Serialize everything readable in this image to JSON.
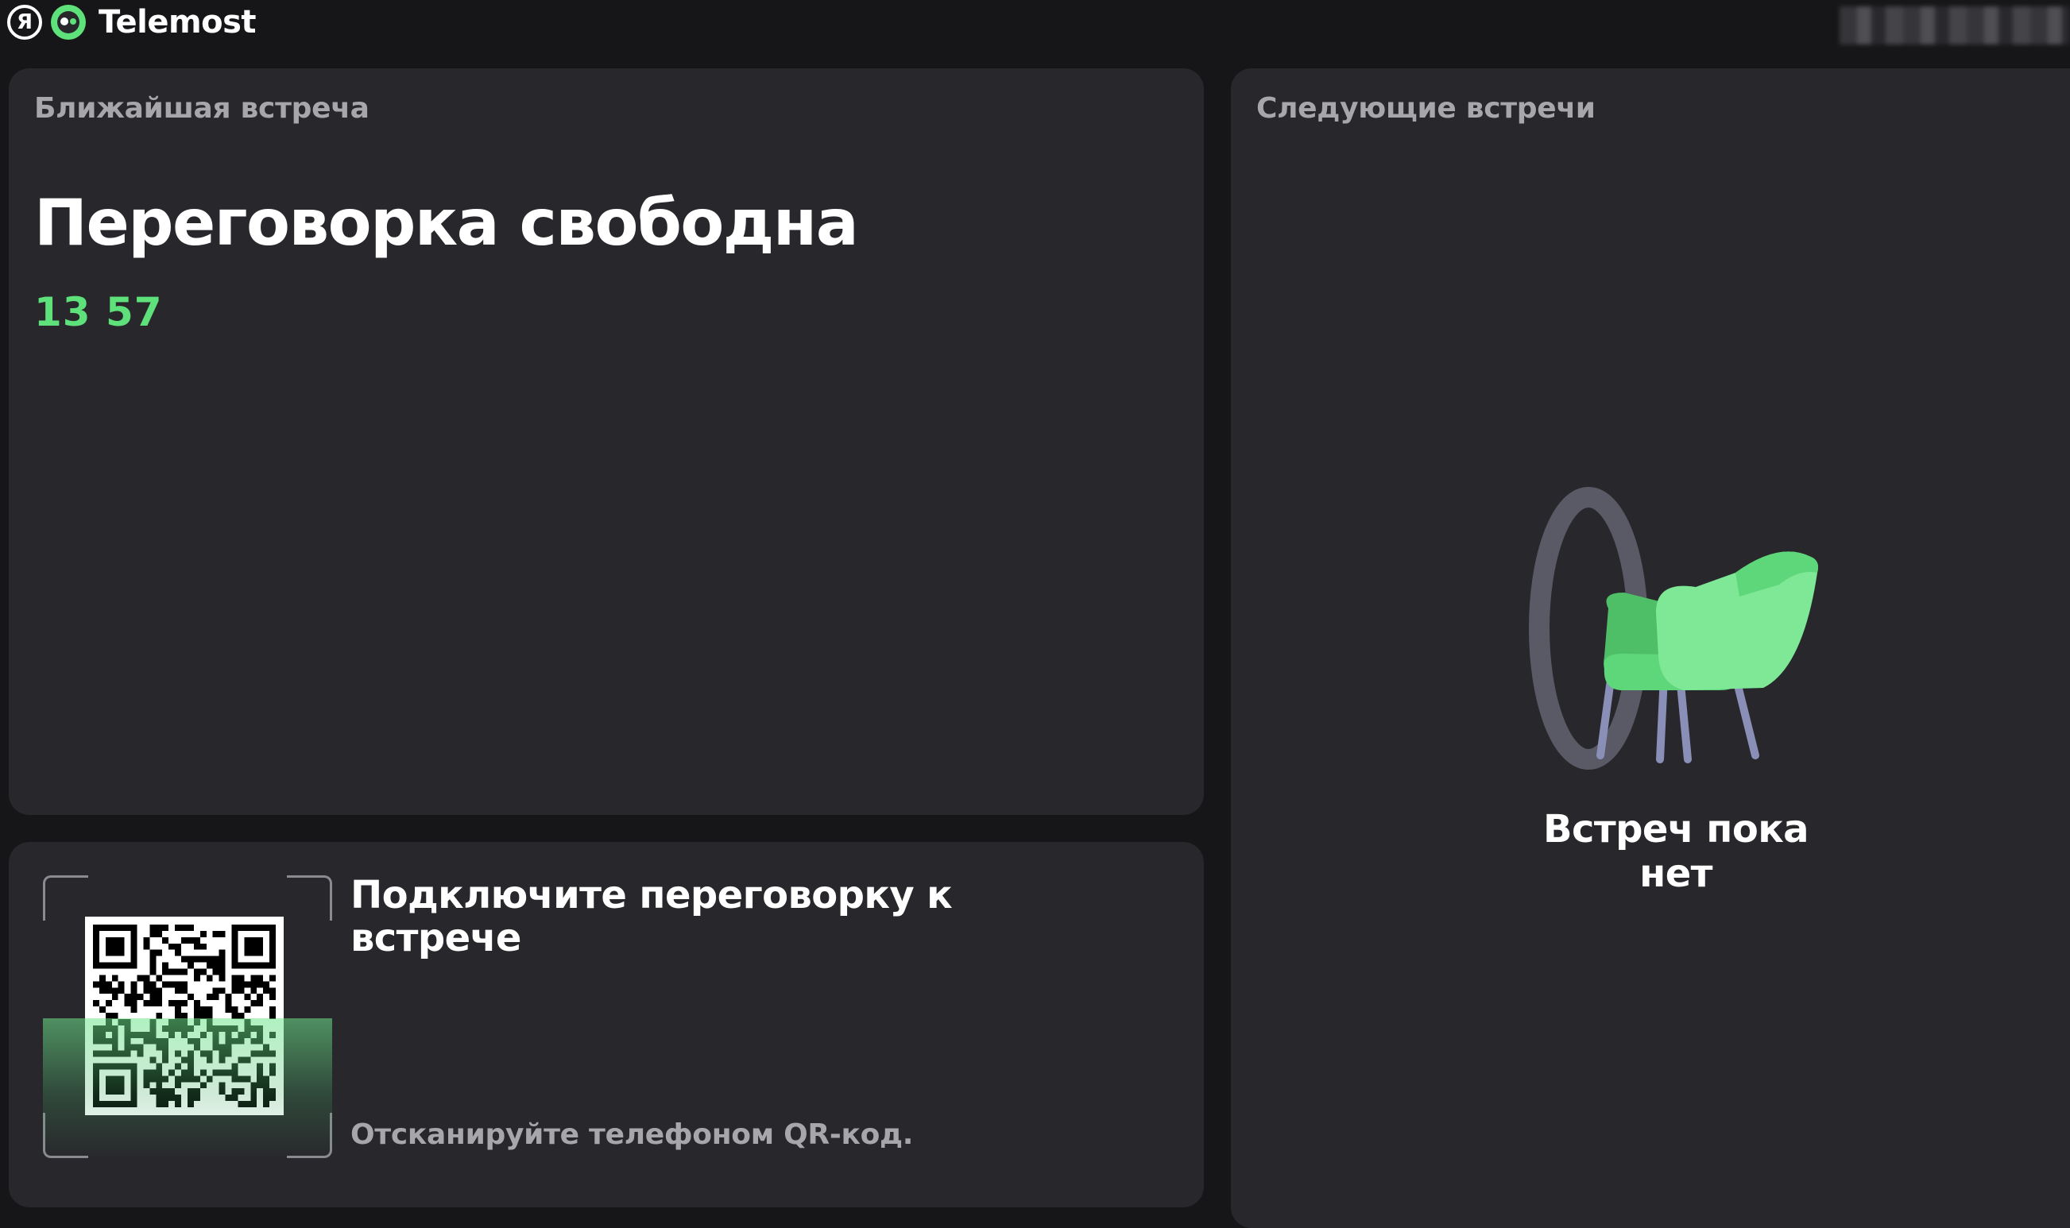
{
  "header": {
    "brand_glyph": "Я",
    "app_title": "Telemost",
    "brand_icon": "yandex-logo-icon",
    "app_icon": "telemost-logo-icon"
  },
  "nearest": {
    "label": "Ближайшая встреча",
    "status": "Переговорка свободна",
    "time": "13 57"
  },
  "connect": {
    "title": "Подключите переговорку к встрече",
    "hint": "Отсканируйте телефоном QR-код.",
    "qr_icon": "qr-code-icon"
  },
  "next": {
    "label": "Следующие встречи",
    "empty_text": "Встреч пока нет",
    "illustration": "empty-chair-illustration"
  },
  "colors": {
    "background": "#161618",
    "card": "#28282c",
    "accent_green": "#5ee07a",
    "muted_text": "#a6a6ab"
  }
}
